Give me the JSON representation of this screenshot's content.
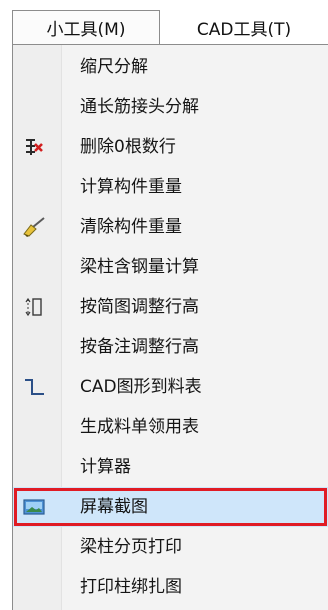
{
  "menubar": {
    "tabs": [
      {
        "label": "小工具(M)"
      },
      {
        "label": "CAD工具(T)"
      }
    ]
  },
  "menu": {
    "items": [
      {
        "label": "缩尺分解",
        "icon": null
      },
      {
        "label": "通长筋接头分解",
        "icon": null
      },
      {
        "label": "删除0根数行",
        "icon": "delete-rows-icon"
      },
      {
        "label": "计算构件重量",
        "icon": null
      },
      {
        "label": "清除构件重量",
        "icon": "broom-icon"
      },
      {
        "label": "梁柱含钢量计算",
        "icon": null
      },
      {
        "label": "按简图调整行高",
        "icon": "row-height-icon"
      },
      {
        "label": "按备注调整行高",
        "icon": null
      },
      {
        "label": "CAD图形到料表",
        "icon": "cad-shape-icon"
      },
      {
        "label": "生成料单领用表",
        "icon": null
      },
      {
        "label": "计算器",
        "icon": null
      },
      {
        "label": "屏幕截图",
        "icon": "screenshot-icon",
        "highlighted": true
      },
      {
        "label": "梁柱分页打印",
        "icon": null
      },
      {
        "label": "打印柱绑扎图",
        "icon": null
      }
    ]
  },
  "colors": {
    "highlight_bg": "#cfe6fa",
    "highlight_border": "#e01b24"
  }
}
